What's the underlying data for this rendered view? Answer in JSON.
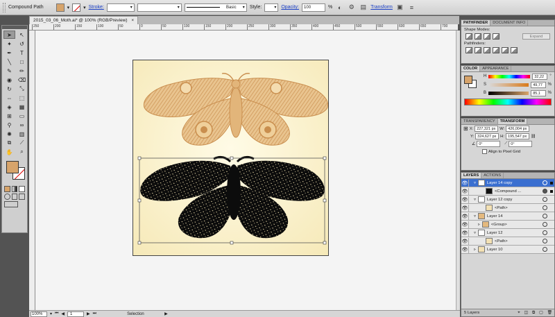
{
  "control_bar": {
    "object_type": "Compound Path",
    "stroke_label": "Stroke:",
    "brush_label": "Basic",
    "style_label": "Style:",
    "opacity_label": "Opacity:",
    "opacity_value": "100",
    "percent": "%",
    "transform_label": "Transform"
  },
  "document": {
    "tab_title": "2015_03_06_Moth.ai* @ 100% (RGB/Preview)",
    "close": "×"
  },
  "ruler": {
    "ticks": [
      "250",
      "200",
      "150",
      "100",
      "50",
      "0",
      "50",
      "100",
      "150",
      "200",
      "250",
      "300",
      "350",
      "400",
      "450",
      "500",
      "550",
      "600",
      "650",
      "700"
    ]
  },
  "status_bar": {
    "zoom": "100%",
    "page": "1",
    "mode": "Selection"
  },
  "pathfinder": {
    "tabs": [
      "PATHFINDER",
      "DOCUMENT INFO"
    ],
    "shape_modes_label": "Shape Modes:",
    "pathfinders_label": "Pathfinders:",
    "expand_label": "Expand"
  },
  "color": {
    "tabs": [
      "COLOR",
      "APPEARANCE"
    ],
    "h_label": "H",
    "h_value": "32,22",
    "s_label": "S",
    "s_value": "49,77",
    "b_label": "B",
    "b_value": "85,1",
    "deg": "°",
    "pct": "%"
  },
  "transform": {
    "tabs": [
      "TRANSPARENCY",
      "TRANSFORM"
    ],
    "x_label": "X:",
    "x_value": "227,321 px",
    "y_label": "Y:",
    "y_value": "324,627 px",
    "w_label": "W:",
    "w_value": "426,004 px",
    "h_label": "H:",
    "h_value": "195,547 px",
    "angle_value": "0°",
    "shear_value": "0°",
    "align_label": "Align to Pixel Grid"
  },
  "layers": {
    "tabs": [
      "LAYERS",
      "ACTIONS"
    ],
    "items": [
      {
        "name": "Layer 14 copy",
        "selected": true
      },
      {
        "name": "<Compound ...",
        "selected": false
      },
      {
        "name": "Layer 12 copy",
        "selected": false
      },
      {
        "name": "<Path>",
        "selected": false
      },
      {
        "name": "Layer 14",
        "selected": false
      },
      {
        "name": "<Group>",
        "selected": false
      },
      {
        "name": "Layer 12",
        "selected": false
      },
      {
        "name": "<Path>",
        "selected": false
      },
      {
        "name": "Layer 10",
        "selected": false
      }
    ],
    "count_label": "5 Layers"
  },
  "colors": {
    "fill": "#d7a46b",
    "moth_tan": "#e4b97e",
    "moth_dark": "#0c0c0c",
    "selection_blue": "#3a6fd0"
  }
}
